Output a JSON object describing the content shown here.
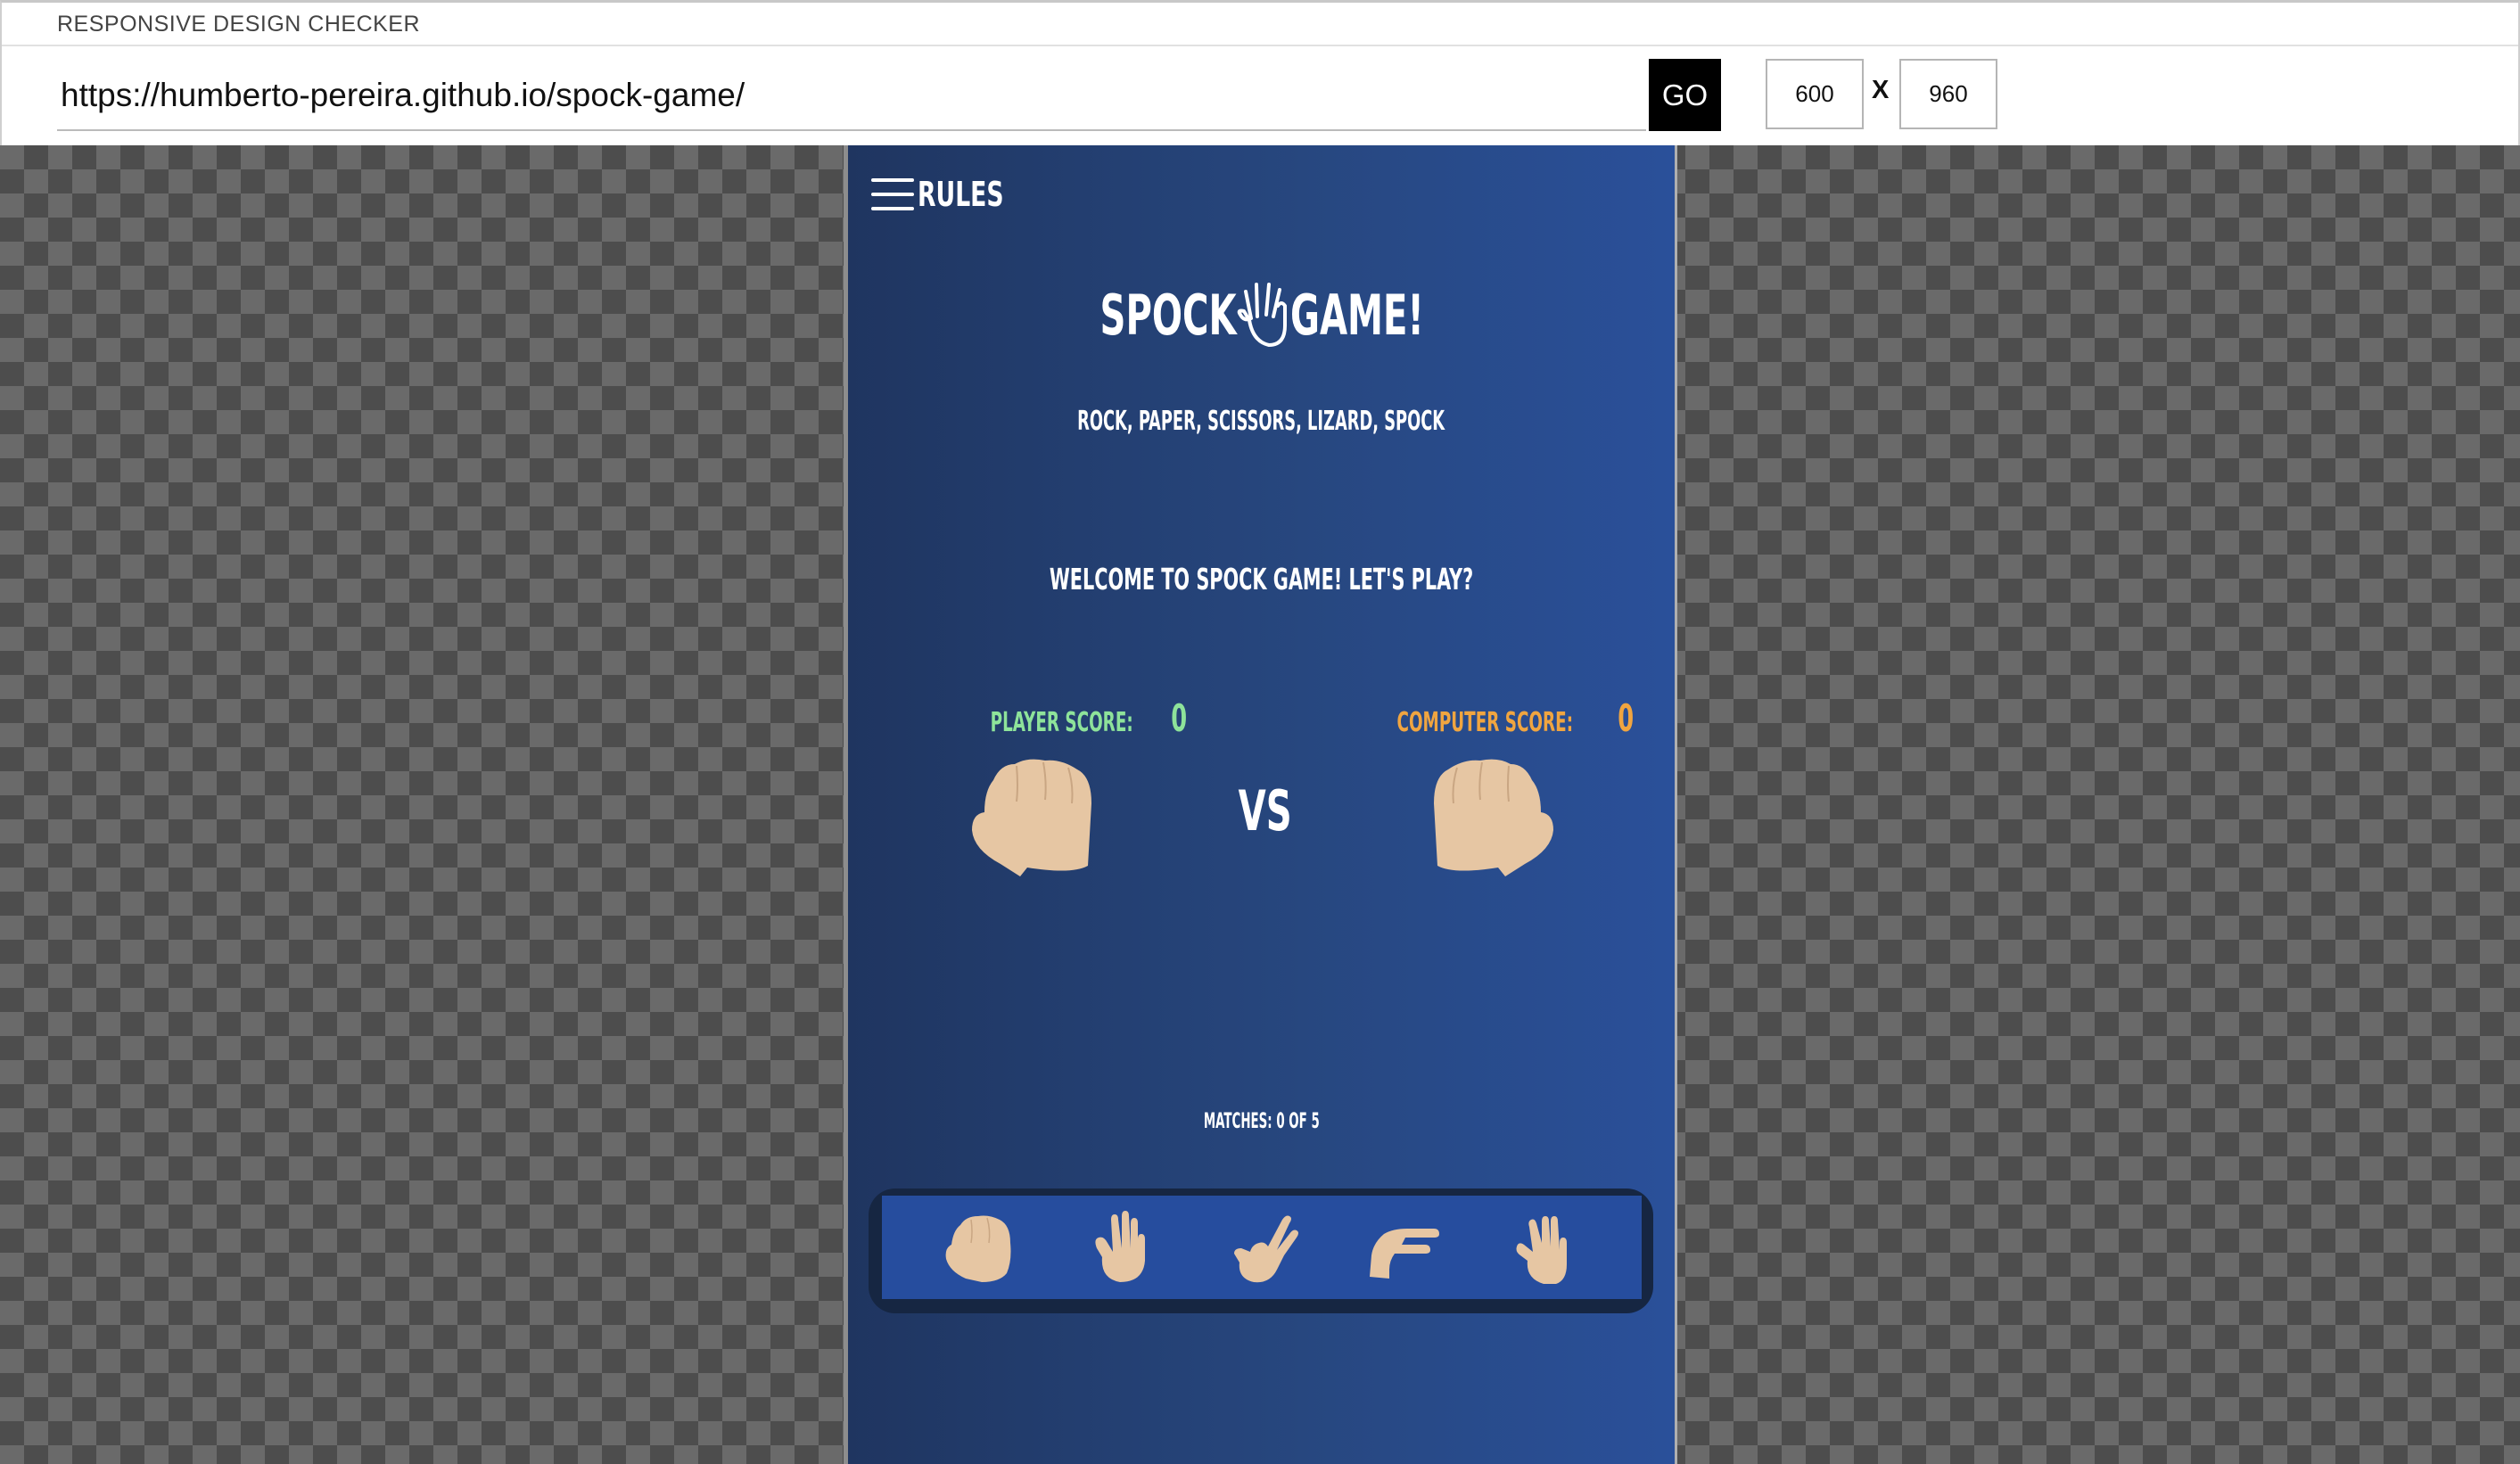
{
  "app": {
    "title": "RESPONSIVE DESIGN CHECKER",
    "url_value": "https://humberto-pereira.github.io/spock-game/",
    "go_label": "GO",
    "width_value": "600",
    "height_value": "960",
    "dimension_separator": "X"
  },
  "game": {
    "rules_label": "RULES",
    "title_left": "SPOCK",
    "title_right": "GAME!",
    "subtitle": "ROCK, PAPER, SCISSORS, LIZARD, SPOCK",
    "welcome": "WELCOME TO SPOCK GAME! LET'S PLAY?",
    "player_score_label": "PLAYER SCORE: ",
    "player_score_value": "0",
    "computer_score_label": "COMPUTER SCORE: ",
    "computer_score_value": "0",
    "vs_label": "VS",
    "matches": "MATCHES: 0 OF 5",
    "choices": [
      {
        "name": "rock",
        "icon": "rock-hand-icon"
      },
      {
        "name": "paper",
        "icon": "paper-hand-icon"
      },
      {
        "name": "scissors",
        "icon": "scissors-hand-icon"
      },
      {
        "name": "lizard",
        "icon": "lizard-hand-icon"
      },
      {
        "name": "spock",
        "icon": "spock-hand-icon"
      }
    ]
  },
  "colors": {
    "background_start": "#1f3560",
    "background_end": "#2a509a",
    "player_score": "#8ee39a",
    "computer_score": "#f0a540",
    "skin": "#e6c6a3",
    "choices_bar": "#264d9e"
  }
}
